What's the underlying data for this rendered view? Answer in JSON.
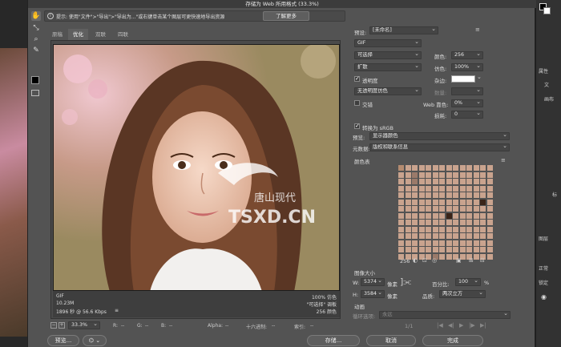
{
  "dialog": {
    "title": "存储为 Web 所用格式 (33.3%)",
    "hint": "提示: 使用\"文件\">\"导出\">\"导出为...\"或右键单击某个图层可更快速地导出资源",
    "learn_more": "了解更多"
  },
  "tabs": [
    "原稿",
    "优化",
    "双联",
    "四联"
  ],
  "preview": {
    "watermark_top": "唐山现代",
    "watermark_bottom": "TSXD.CN",
    "info_left": [
      "GIF",
      "10.23M",
      "1896 秒 @ 56.6 Kbps"
    ],
    "info_left_menu": "≡",
    "info_right": [
      "100% 仿色",
      "\"可选择\" 调板",
      "256 颜色"
    ]
  },
  "status": {
    "zoom": "33.3%",
    "r_label": "R:",
    "r_value": "--",
    "g_label": "G:",
    "g_value": "--",
    "b_label": "B:",
    "b_value": "--",
    "alpha_label": "Alpha:",
    "alpha_value": "--",
    "hex_label": "十六进制:",
    "hex_value": "--",
    "index_label": "索引:",
    "index_value": "--"
  },
  "buttons": {
    "preview": "预览...",
    "save": "存储...",
    "cancel": "取消",
    "done": "完成"
  },
  "settings": {
    "preset_label": "预设:",
    "preset_value": "[未命名]",
    "format": "GIF",
    "reduction": "可选择",
    "dither_algo": "扩散",
    "colors_label": "颜色:",
    "colors_value": "256",
    "dither_label": "仿色:",
    "dither_value": "100%",
    "transparency_label": "透明度",
    "transparency_checked": true,
    "matte_label": "杂边:",
    "trans_dither": "无透明度仿色",
    "amount_label": "数量:",
    "interlaced_label": "交错",
    "interlaced_checked": false,
    "web_snap_label": "Web 靠色:",
    "web_snap_value": "0%",
    "lossy_label": "损耗:",
    "lossy_value": "0",
    "srgb_label": "转换为 sRGB",
    "srgb_checked": true,
    "preview_label": "预览:",
    "preview_value": "显示器颜色",
    "metadata_label": "元数据:",
    "metadata_value": "版权和联系信息",
    "color_table_label": "颜色表",
    "palette_count": "256",
    "image_size_label": "图像大小",
    "w_label": "W:",
    "w_value": "5374",
    "h_label": "H:",
    "h_value": "3584",
    "unit": "像素",
    "percent_label": "百分比:",
    "percent_value": "100",
    "percent_unit": "%",
    "quality_label": "品质:",
    "quality_value": "两次立方",
    "animation_label": "动画",
    "loop_label": "循环选项:",
    "loop_value": "永远",
    "frame_counter": "1/1"
  },
  "ps_background": {
    "right_labels": [
      "属性",
      "文",
      "画布",
      "标",
      "图层",
      "正常",
      "锁定"
    ]
  }
}
